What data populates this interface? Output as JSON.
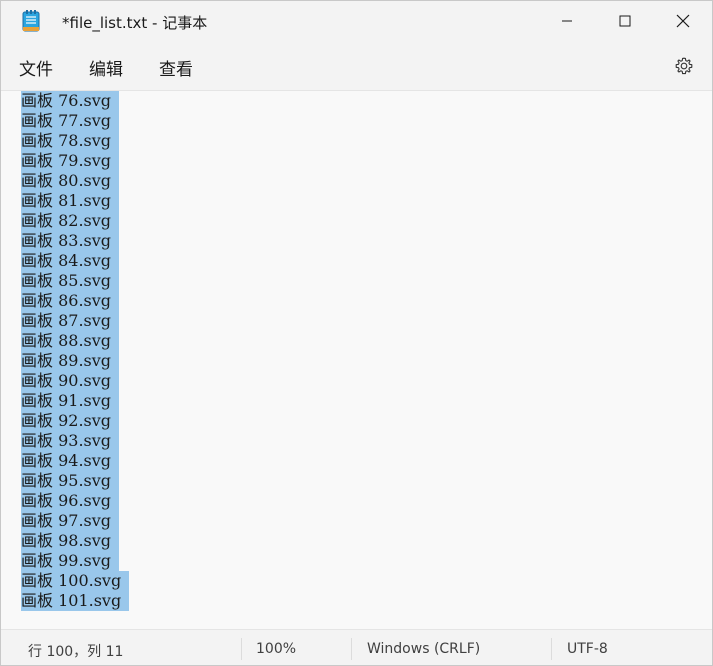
{
  "window": {
    "title": "*file_list.txt - 记事本"
  },
  "menu": {
    "file": "文件",
    "edit": "编辑",
    "view": "查看"
  },
  "editor": {
    "lines": [
      "画板 76.svg",
      "画板 77.svg",
      "画板 78.svg",
      "画板 79.svg",
      "画板 80.svg",
      "画板 81.svg",
      "画板 82.svg",
      "画板 83.svg",
      "画板 84.svg",
      "画板 85.svg",
      "画板 86.svg",
      "画板 87.svg",
      "画板 88.svg",
      "画板 89.svg",
      "画板 90.svg",
      "画板 91.svg",
      "画板 92.svg",
      "画板 93.svg",
      "画板 94.svg",
      "画板 95.svg",
      "画板 96.svg",
      "画板 97.svg",
      "画板 98.svg",
      "画板 99.svg",
      "画板 100.svg",
      "画板 101.svg"
    ],
    "selection_color": "#99c7eb"
  },
  "status": {
    "position": "行 100，列 11",
    "zoom": "100%",
    "line_ending": "Windows (CRLF)",
    "encoding": "UTF-8"
  }
}
